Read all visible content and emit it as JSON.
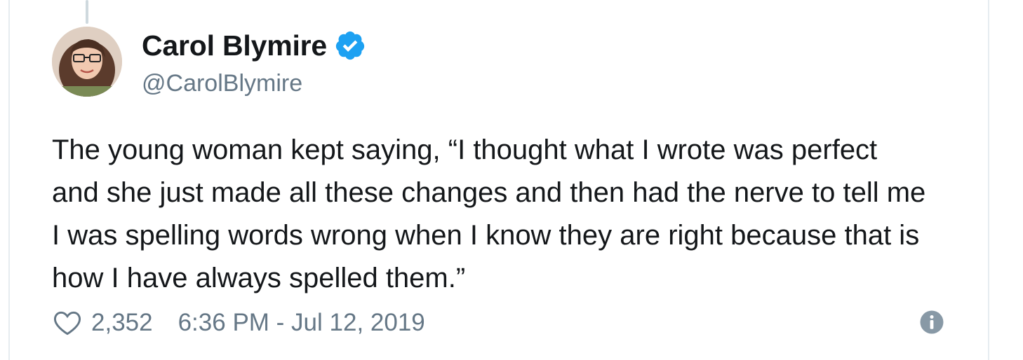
{
  "tweet": {
    "author": {
      "display_name": "Carol Blymire",
      "handle": "@CarolBlymire",
      "verified": true,
      "verified_color": "#1da1f2"
    },
    "text": "The young woman kept saying, “I thought what I wrote was perfect and she just made all these changes and then had the nerve to tell me I was spelling words wrong when I know they are right because that is how I have always spelled them.”",
    "likes": "2,352",
    "timestamp": "6:36 PM - Jul 12, 2019"
  },
  "icons": {
    "like": "heart-outline-icon",
    "verified": "verified-badge-icon",
    "info": "info-circle-icon"
  },
  "colors": {
    "text": "#14171a",
    "secondary": "#657786",
    "border": "#e6ecf0"
  }
}
